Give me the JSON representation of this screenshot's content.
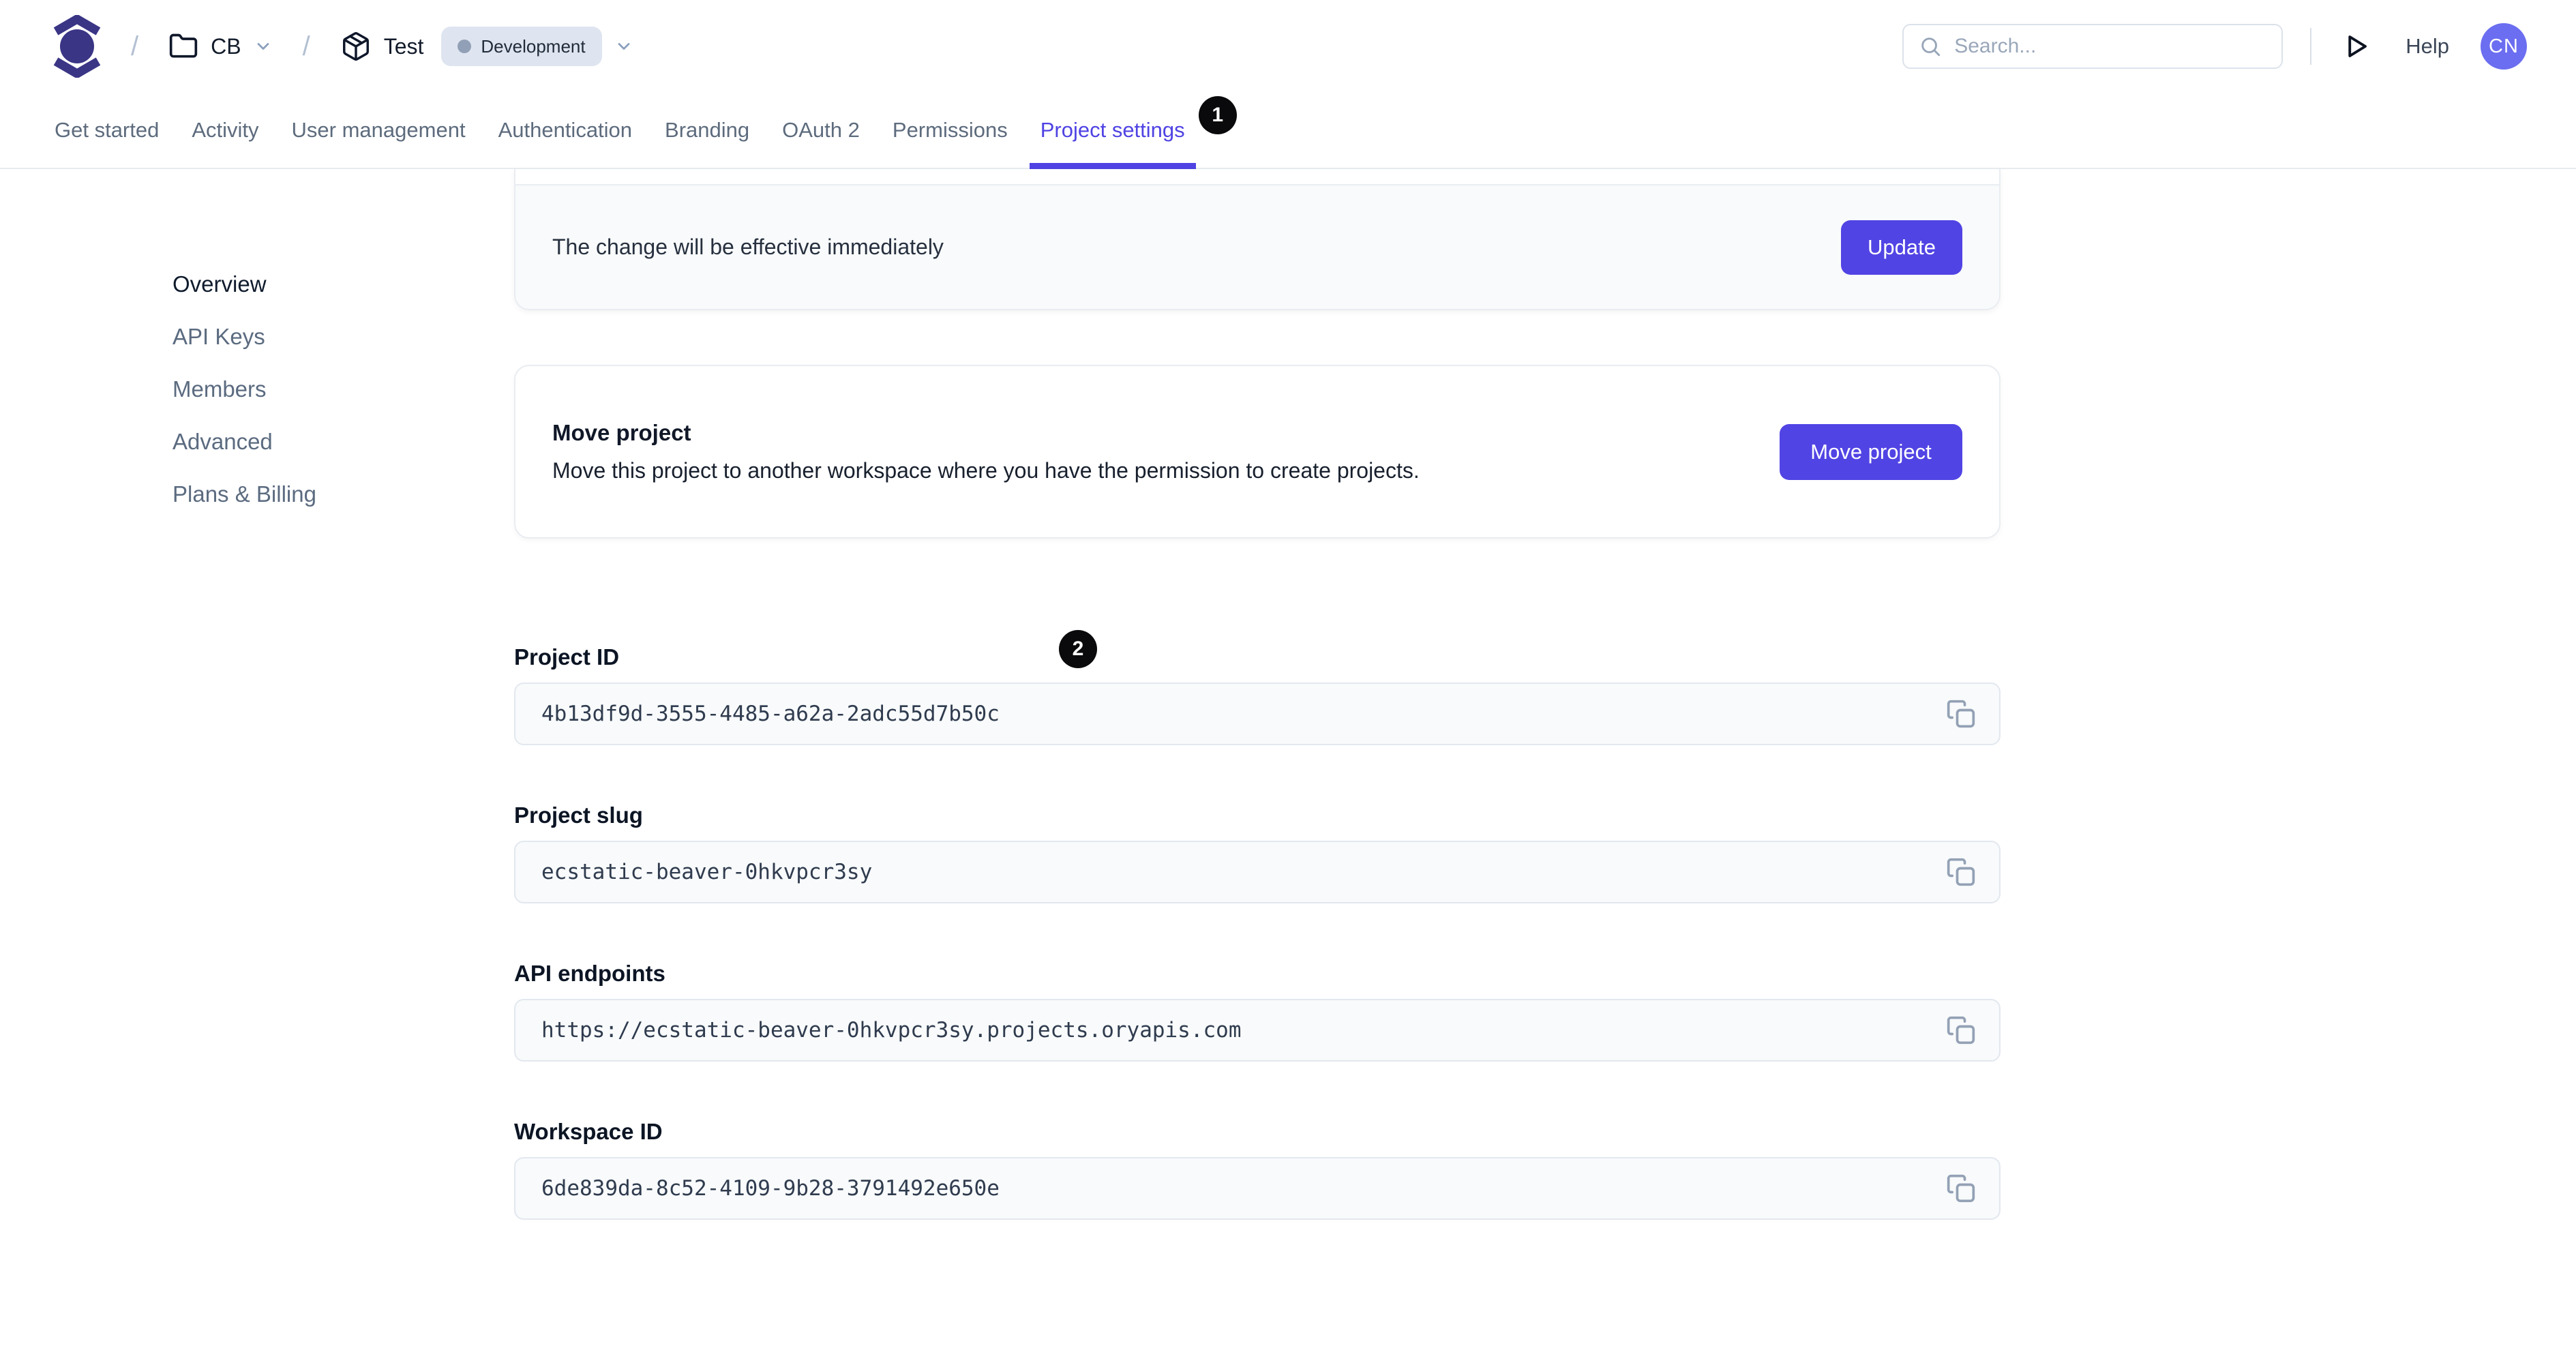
{
  "header": {
    "breadcrumb_separator": "/",
    "workspace": {
      "label": "CB"
    },
    "project": {
      "label": "Test",
      "environment": "Development"
    },
    "search": {
      "placeholder": "Search..."
    },
    "help_label": "Help",
    "avatar": {
      "initials": "CN"
    }
  },
  "tabs": {
    "items": [
      {
        "label": "Get started"
      },
      {
        "label": "Activity"
      },
      {
        "label": "User management"
      },
      {
        "label": "Authentication"
      },
      {
        "label": "Branding"
      },
      {
        "label": "OAuth 2"
      },
      {
        "label": "Permissions"
      },
      {
        "label": "Project settings"
      }
    ],
    "active_tab": "Project settings",
    "active_badge": "1"
  },
  "sidebar": {
    "items": [
      {
        "label": "Overview"
      },
      {
        "label": "API Keys"
      },
      {
        "label": "Members"
      },
      {
        "label": "Advanced"
      },
      {
        "label": "Plans & Billing"
      }
    ],
    "active_item": "Overview"
  },
  "main": {
    "update_card": {
      "message": "The change will be effective immediately",
      "button_label": "Update"
    },
    "move_card": {
      "title": "Move project",
      "description": "Move this project to another workspace where you have the permission to create projects.",
      "button_label": "Move project"
    },
    "fields_badge": "2",
    "fields": [
      {
        "label": "Project ID",
        "value": "4b13df9d-3555-4485-a62a-2adc55d7b50c"
      },
      {
        "label": "Project slug",
        "value": "ecstatic-beaver-0hkvpcr3sy"
      },
      {
        "label": "API endpoints",
        "value": "https://ecstatic-beaver-0hkvpcr3sy.projects.oryapis.com"
      },
      {
        "label": "Workspace ID",
        "value": "6de839da-8c52-4109-9b28-3791492e650e"
      }
    ]
  },
  "icons": {
    "logo": "ory-logo-icon",
    "workspace": "folder-icon",
    "project": "package-icon",
    "dropdown": "chevron-down-icon",
    "search": "search-icon",
    "run": "play-icon",
    "copy": "copy-icon"
  },
  "colors": {
    "accent": "#5144e4",
    "active_tab": "#4f43e3",
    "logo": "#3a3585",
    "avatar_bg": "#6b6ef0",
    "annotation_badge_bg": "#0a0a0c",
    "env_badge_bg": "#dfe5f0",
    "field_bg": "#f8fafb",
    "border": "#e7ebef"
  }
}
